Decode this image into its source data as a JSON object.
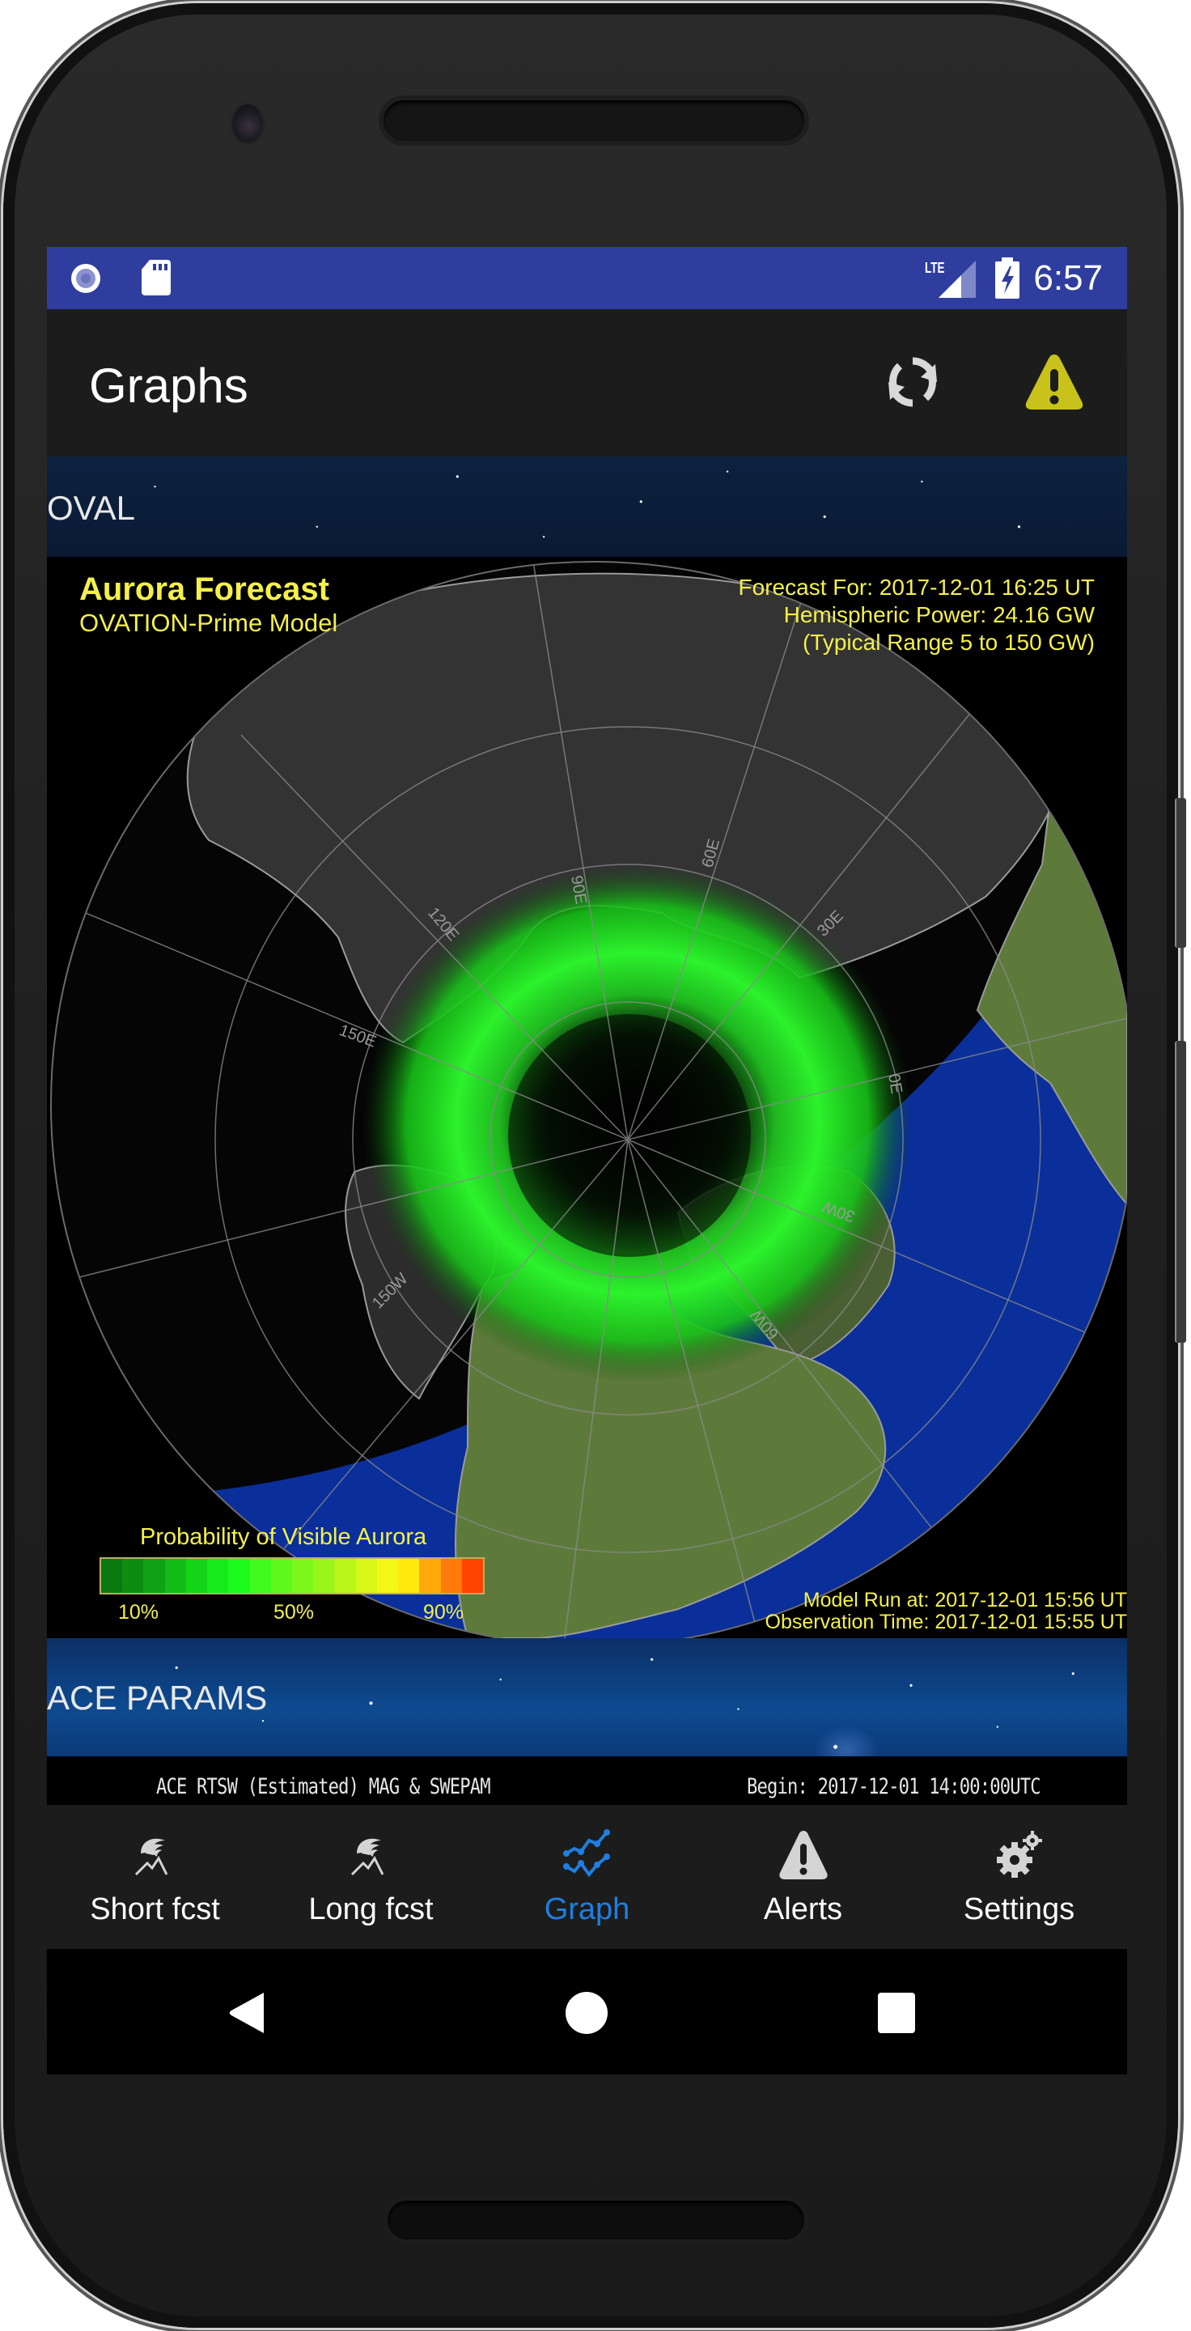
{
  "status_bar": {
    "time": "6:57",
    "network": "LTE",
    "icons": [
      "record-icon",
      "sd-card-icon",
      "lte-signal-icon",
      "battery-charging-icon"
    ],
    "bar_color": "#2F3E9E"
  },
  "app_bar": {
    "title": "Graphs",
    "actions": [
      {
        "name": "refresh",
        "icon": "refresh-icon"
      },
      {
        "name": "alert",
        "icon": "warning-icon",
        "color": "#C9C21A"
      }
    ]
  },
  "sections": {
    "oval": {
      "label": "OVAL"
    },
    "ace": {
      "label": "ACE PARAMS"
    }
  },
  "aurora_map": {
    "title": "Aurora Forecast",
    "subtitle": "OVATION-Prime Model",
    "forecast_for": "Forecast For: 2017-12-01 16:25 UT",
    "hemispheric_power": "Hemispheric Power: 24.16 GW",
    "typical_range": "(Typical Range 5 to 150 GW)",
    "model_run": "Model Run at: 2017-12-01 15:56 UT",
    "observation_time": "Observation Time: 2017-12-01 15:55 UT",
    "longitude_labels": [
      "90E",
      "60E",
      "120E",
      "150E",
      "30E",
      "0E",
      "30W",
      "60W",
      "150W"
    ],
    "legend": {
      "title": "Probability of Visible Aurora",
      "ticks": [
        "10%",
        "50%",
        "90%"
      ],
      "colors": [
        "#0a7a10",
        "#0d8c12",
        "#0fa214",
        "#12bb16",
        "#14d418",
        "#17ea1b",
        "#1dfa1e",
        "#40fb1d",
        "#5ef91c",
        "#7cf71b",
        "#9af51a",
        "#b9f519",
        "#d8f718",
        "#f3f716",
        "#ffe80e",
        "#ffa80a",
        "#ff7a08",
        "#ff4402"
      ]
    },
    "colors": {
      "text": "#F4F04A",
      "aurora": "#22FF22",
      "land_day": "#5D7A3A",
      "ocean_day": "#0A2F9A",
      "land_night": "#333333"
    }
  },
  "ace_chart": {
    "left_label": "ACE RTSW (Estimated) MAG & SWEPAM",
    "right_label": "Begin: 2017-12-01 14:00:00UTC"
  },
  "bottom_nav": {
    "items": [
      {
        "label": "Short fcst",
        "icon": "aurora-mountain-icon",
        "active": false
      },
      {
        "label": "Long fcst",
        "icon": "aurora-mountain-icon",
        "active": false
      },
      {
        "label": "Graph",
        "icon": "graph-icon",
        "active": true
      },
      {
        "label": "Alerts",
        "icon": "warning-icon",
        "active": false
      },
      {
        "label": "Settings",
        "icon": "gears-icon",
        "active": false
      }
    ],
    "active_color": "#1E7FE0"
  },
  "system_nav": {
    "buttons": [
      "back",
      "home",
      "recents"
    ]
  }
}
